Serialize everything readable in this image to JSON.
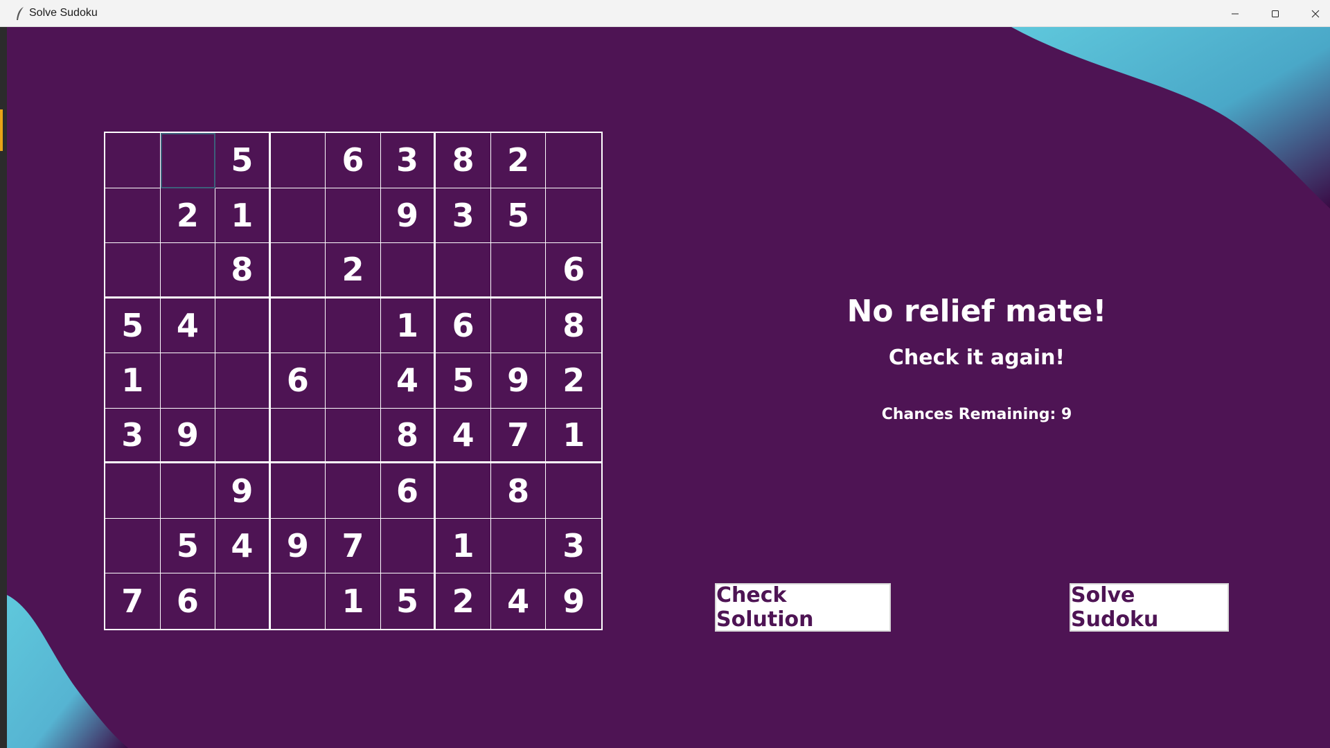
{
  "window": {
    "title": "Solve Sudoku",
    "icon": "feather-icon",
    "controls": [
      "minimize-icon",
      "maximize-icon",
      "close-icon"
    ]
  },
  "colors": {
    "background": "#4e1454",
    "accent_wave": "#5fc8dc",
    "grid_lines": "#ffffff",
    "button_text": "#4e1454"
  },
  "board": {
    "selected_cell": [
      0,
      1
    ],
    "rows": [
      [
        "",
        "",
        "5",
        "",
        "6",
        "3",
        "8",
        "2",
        ""
      ],
      [
        "",
        "2",
        "1",
        "",
        "",
        "9",
        "3",
        "5",
        ""
      ],
      [
        "",
        "",
        "8",
        "",
        "2",
        "",
        "",
        "",
        "6"
      ],
      [
        "5",
        "4",
        "",
        "",
        "",
        "1",
        "6",
        "",
        "8"
      ],
      [
        "1",
        "",
        "",
        "6",
        "",
        "4",
        "5",
        "9",
        "2"
      ],
      [
        "3",
        "9",
        "",
        "",
        "",
        "8",
        "4",
        "7",
        "1"
      ],
      [
        "",
        "",
        "9",
        "",
        "",
        "6",
        "",
        "8",
        ""
      ],
      [
        "",
        "5",
        "4",
        "9",
        "7",
        "",
        "1",
        "",
        "3"
      ],
      [
        "7",
        "6",
        "",
        "",
        "1",
        "5",
        "2",
        "4",
        "9"
      ]
    ]
  },
  "status": {
    "heading": "No relief mate!",
    "subheading": "Check it again!",
    "chances": "Chances Remaining: 9"
  },
  "buttons": {
    "check": "Check Solution",
    "solve": "Solve Sudoku"
  }
}
